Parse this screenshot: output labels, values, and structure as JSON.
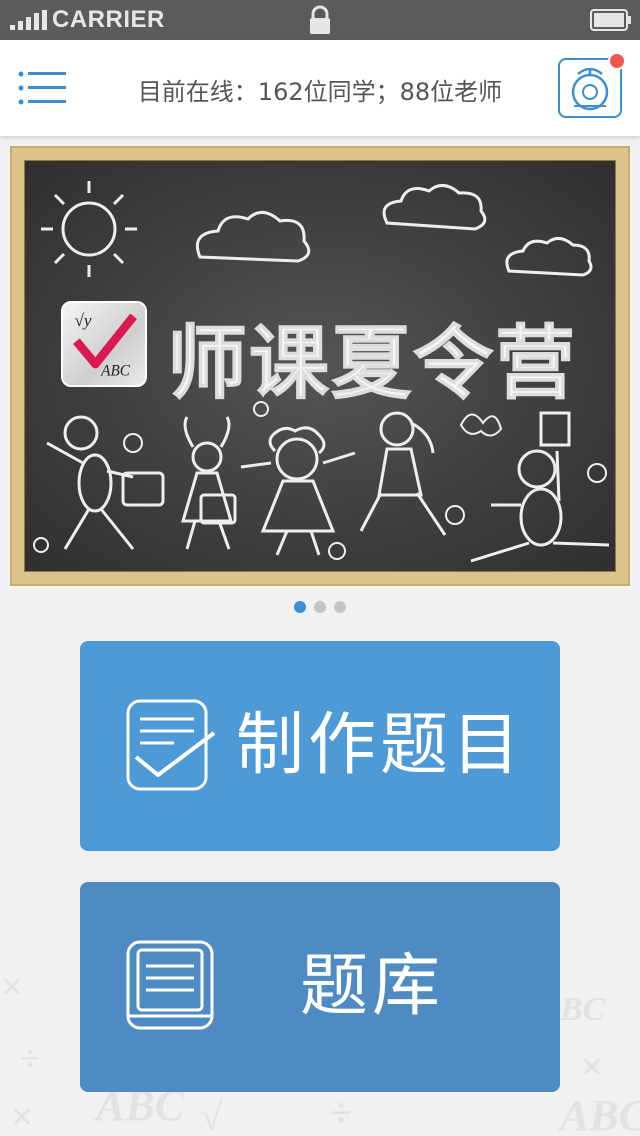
{
  "status_bar": {
    "carrier": "CARRIER",
    "icons": [
      "signal-icon",
      "lock-icon",
      "battery-icon"
    ]
  },
  "header": {
    "online_text": "目前在线：162位同学；88位老师",
    "menu_icon": "hamburger-menu-icon",
    "bell_icon": "bell-icon",
    "accent_color": "#3b8fd0",
    "badge_color": "#f2564f"
  },
  "banner": {
    "title": "师课夏令营",
    "logo_text": "ABC",
    "pager": {
      "count": 3,
      "active": 0
    }
  },
  "actions": {
    "create": {
      "label": "制作题目",
      "icon": "checklist-icon",
      "color": "#4e9ad6"
    },
    "bank": {
      "label": "题库",
      "icon": "book-icon",
      "color": "#4f8bc3"
    }
  }
}
